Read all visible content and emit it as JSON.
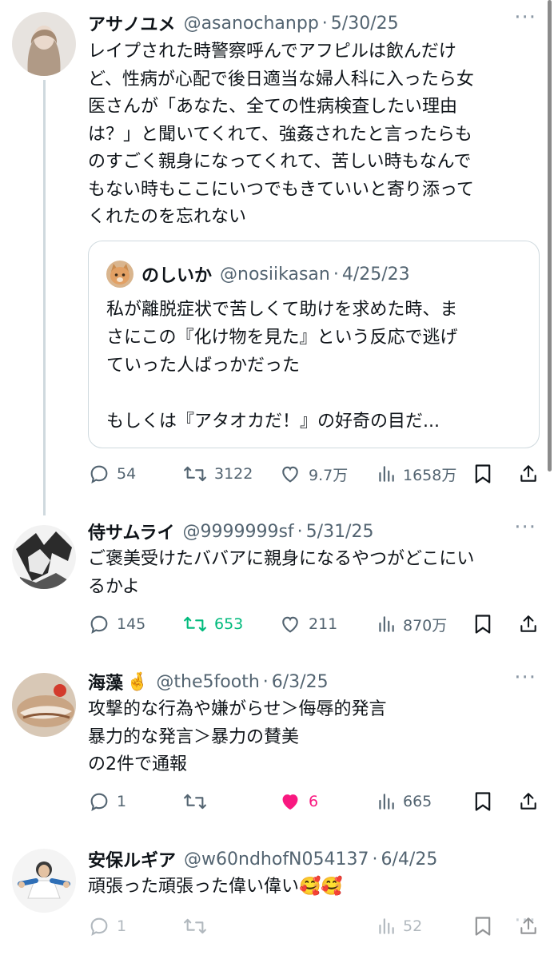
{
  "tweets": [
    {
      "name": "アサノユメ",
      "handle": "@asanochanpp",
      "date": "5/30/25",
      "text": "レイプされた時警察呼んでアフピルは飲んだけ\nど、性病が心配で後日適当な婦人科に入ったら女\n医さんが「あなた、全ての性病検査したい理由\nは？」と聞いてくれて、強姦されたと言ったらも\nのすごく親身になってくれて、苦しい時もなんで\nもない時もここにいつでもきていいと寄り添って\nくれたのを忘れない",
      "quote": {
        "name": "のしいか",
        "handle": "@nosiikasan",
        "date": "4/25/23",
        "text": "私が離脱症状で苦しくて助けを求めた時、ま\nさにこの『化け物を見た』という反応で逃げ\nていった人ばっかだった\n\nもしくは『アタオカだ！』の好奇の目だ..."
      },
      "replies": "54",
      "reposts": "3122",
      "likes": "9.7万",
      "views": "1658万"
    },
    {
      "name": "侍サムライ",
      "handle": "@9999999sf",
      "date": "5/31/25",
      "text": "ご褒美受けたババアに親身になるやつがどこにい\nるかよ",
      "replies": "145",
      "reposts": "653",
      "likes": "211",
      "views": "870万"
    },
    {
      "name": "海藻",
      "name_emoji": "🤞",
      "handle": "@the5footh",
      "date": "6/3/25",
      "text": "攻撃的な行為や嫌がらせ＞侮辱的発言\n暴力的な発言＞暴力の賛美\nの2件で通報",
      "replies": "1",
      "reposts": "",
      "likes": "6",
      "views": "665"
    },
    {
      "name": "安保ルギア",
      "handle": "@w60ndhofN054137",
      "date": "6/4/25",
      "text": "頑張った頑張った偉い偉い🥰🥰",
      "replies": "1",
      "reposts": "",
      "likes": "",
      "views": "52"
    }
  ],
  "colors": {
    "text": "#0f1419",
    "secondary": "#536471",
    "repost_active": "#00ba7c",
    "like_active": "#f91880",
    "border": "#cfd9de"
  },
  "icons": [
    "reply-icon",
    "repost-icon",
    "like-icon",
    "views-icon",
    "bookmark-icon",
    "share-icon",
    "more-icon"
  ]
}
